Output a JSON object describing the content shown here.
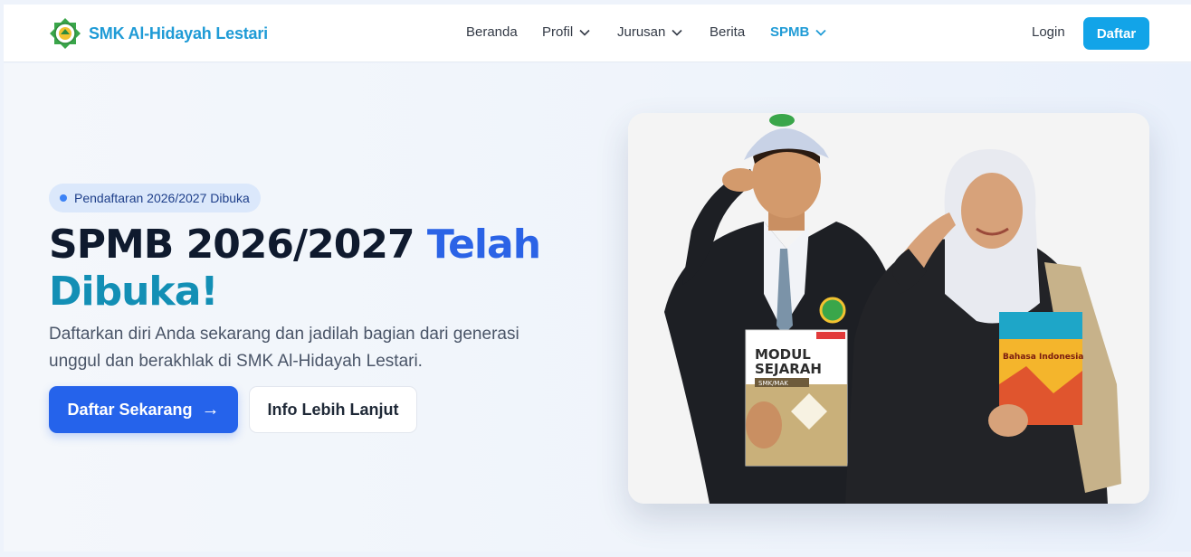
{
  "header": {
    "brand_name": "SMK Al-Hidayah Lestari",
    "nav": [
      {
        "label": "Beranda",
        "has_dropdown": false,
        "active": false
      },
      {
        "label": "Profil",
        "has_dropdown": true,
        "active": false
      },
      {
        "label": "Jurusan",
        "has_dropdown": true,
        "active": false
      },
      {
        "label": "Berita",
        "has_dropdown": false,
        "active": false
      },
      {
        "label": "SPMB",
        "has_dropdown": true,
        "active": true
      }
    ],
    "login_label": "Login",
    "register_label": "Daftar"
  },
  "hero": {
    "badge": "Pendaftaran 2026/2027 Dibuka",
    "title_part1": "SPMB 2026/2027",
    "title_part2": "Telah",
    "title_part3": "Dibuka!",
    "description": "Daftarkan diri Anda sekarang dan jadilah bagian dari generasi unggul dan berakhlak di SMK Al-Hidayah Lestari.",
    "primary_cta": "Daftar Sekarang",
    "primary_cta_icon": "arrow-right-icon",
    "secondary_cta": "Info Lebih Lanjut",
    "photo": {
      "book_left_line1": "MODUL",
      "book_left_line2": "SEJARAH",
      "book_left_line3": "SMK/MAK",
      "book_right_title": "Bahasa Indonesia"
    }
  },
  "colors": {
    "brand": "#1f9bd6",
    "primary": "#2563eb",
    "title_blue": "#2b63e6",
    "title_teal": "#138fb5",
    "register_button": "#12a4e8"
  }
}
